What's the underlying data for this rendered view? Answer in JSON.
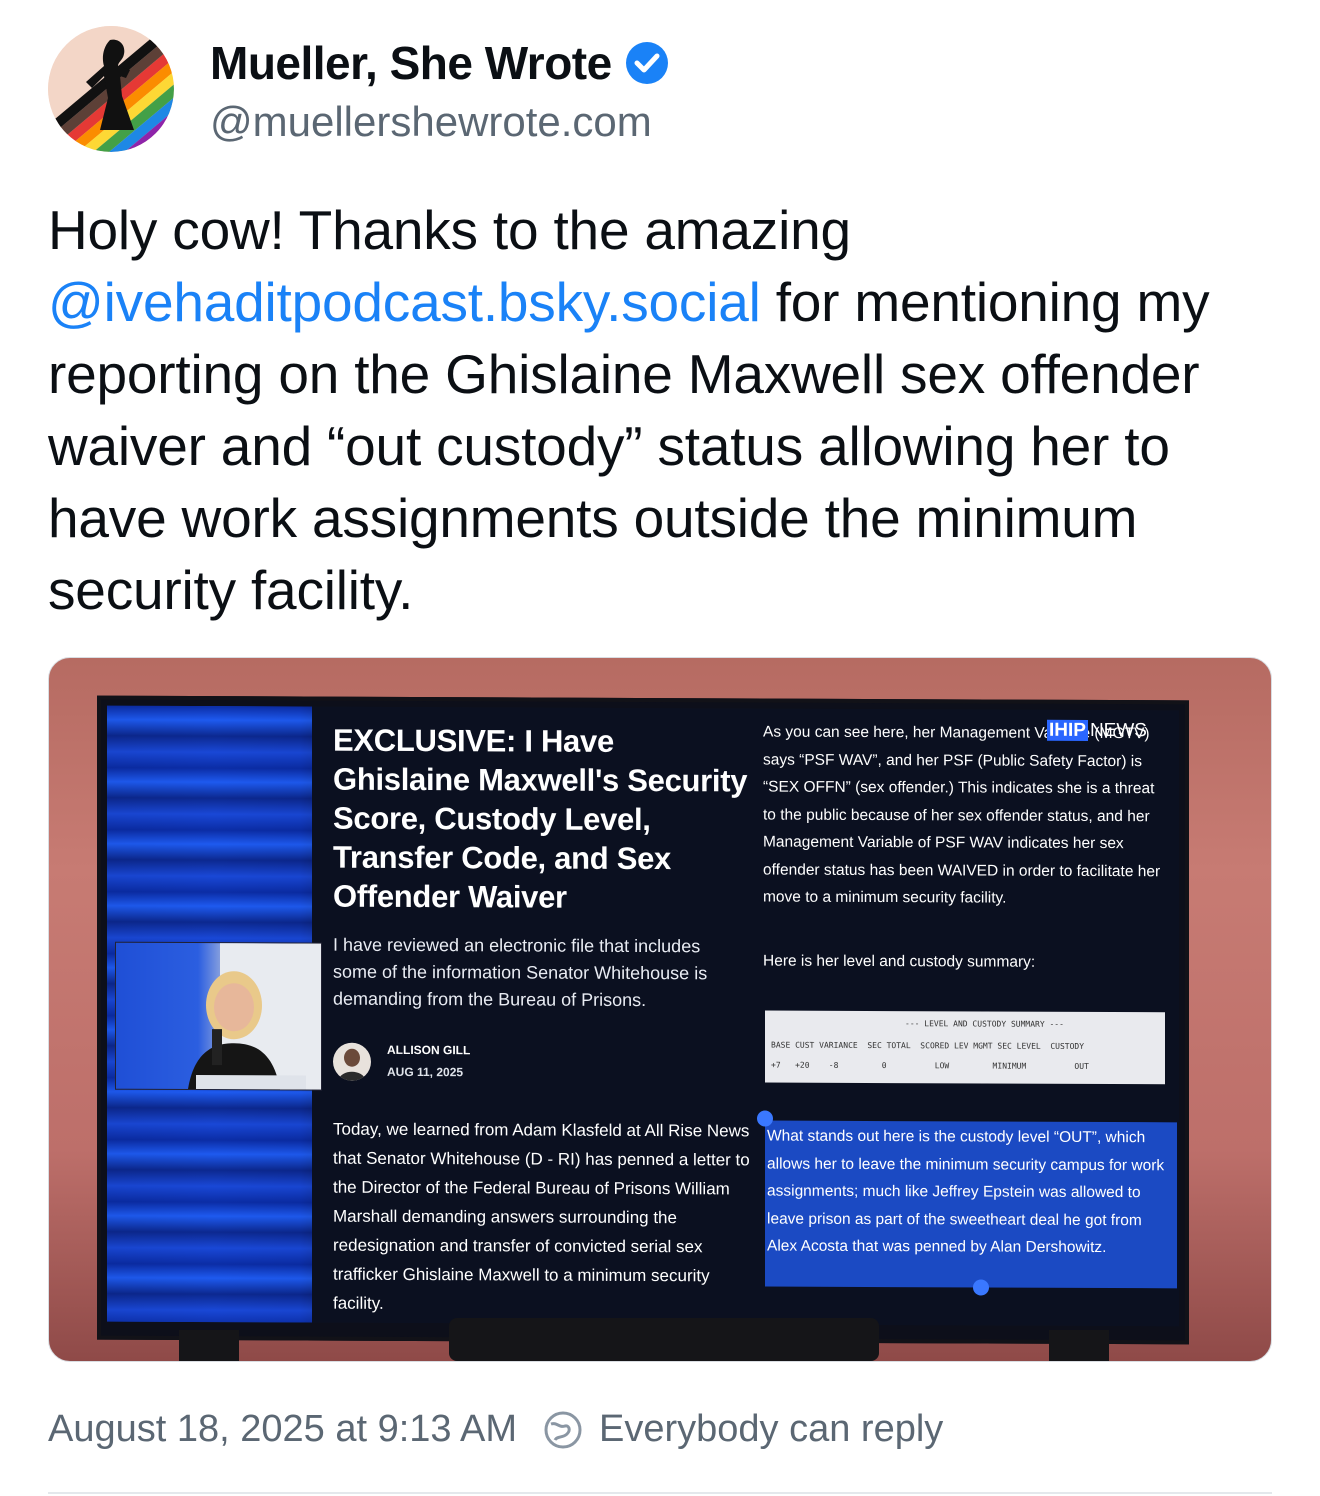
{
  "post": {
    "author": {
      "display_name": "Mueller, She Wrote",
      "handle": "@muellershewrote.com",
      "verified": true,
      "avatar_icon": "avatar-image"
    },
    "text_part1": "Holy cow! Thanks to the amazing ",
    "mention": "@ivehaditpodcast.bsky.social",
    "text_part2": " for mentioning my reporting on the Ghislaine Maxwell sex offender waiver and “out custody” status allowing her to have work assignments outside the minimum security facility.",
    "timestamp": "August 18, 2025 at 9:13 AM",
    "reply_setting": "Everybody can reply"
  },
  "media": {
    "article": {
      "title": "EXCLUSIVE: I Have Ghislaine Maxwell's Security Score, Custody Level, Transfer Code, and Sex Offender Waiver",
      "subtitle": "I have reviewed an electronic file that includes some of the information Senator Whitehouse is demanding from the Bureau of Prisons.",
      "author": "ALLISON GILL",
      "date": "AUG 11, 2025",
      "body": "Today, we learned from Adam Klasfeld at All Rise News that Senator Whitehouse (D - RI) has penned a letter to the Director of the Federal Bureau of Prisons William Marshall demanding answers surrounding the redesignation and transfer of convicted serial sex trafficker Ghislaine Maxwell to a minimum security facility.",
      "right_para": "As you can see here, her Management Variable (MGTV) says “PSF WAV”, and her PSF (Public Safety Factor) is “SEX OFFN” (sex offender.) This indicates she is a threat to the public because of her sex offender status, and her Management Variable of PSF WAV indicates her sex offender status has been WAIVED in order to facilitate her move to a minimum security facility.",
      "summary_label": "Here is her level and custody summary:",
      "summary_title": "--- LEVEL AND CUSTODY SUMMARY ---",
      "summary_columns": "BASE CUST VARIANCE  SEC TOTAL  SCORED LEV MGMT SEC LEVEL  CUSTODY",
      "summary_values": "+7   +20    -8         0          LOW         MINIMUM          OUT",
      "highlighted_para": "What stands out here is the custody level “OUT”, which allows her to leave the minimum security campus for work assignments; much like Jeffrey Epstein was allowed to leave prison as part of the sweetheart deal he got from Alex Acosta that was penned by Alan Dershowitz."
    },
    "channel_badge": "IHIP",
    "channel_badge_suffix": "NEWS"
  },
  "colors": {
    "mention": "#1a82f7",
    "verified": "#1a82f7",
    "muted_text": "#5b6773"
  }
}
